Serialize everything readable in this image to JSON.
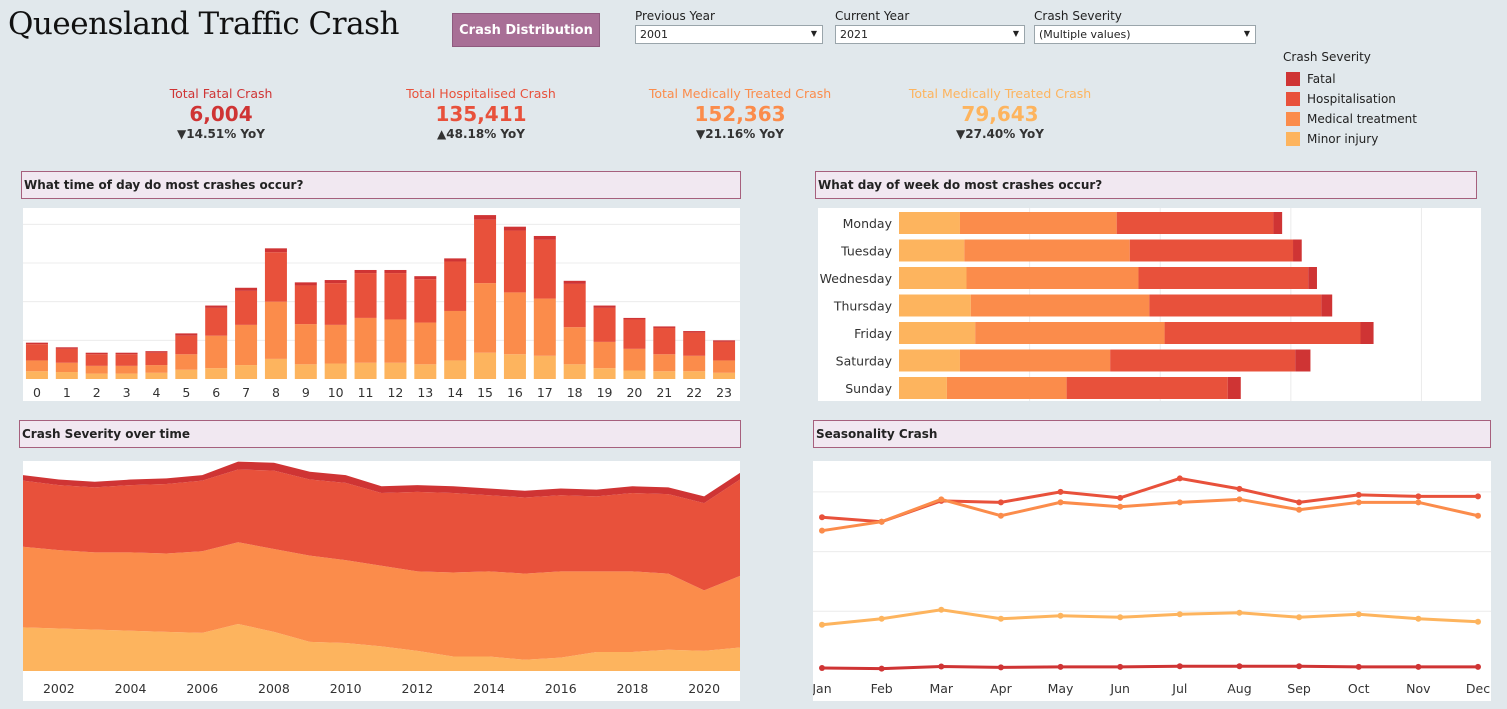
{
  "title": "Queensland Traffic Crash",
  "nav_button": "Crash Distribution",
  "filters": {
    "previous_year": {
      "label": "Previous Year",
      "value": "2001"
    },
    "current_year": {
      "label": "Current Year",
      "value": "2021"
    },
    "severity": {
      "label": "Crash Severity",
      "value": "(Multiple values)"
    }
  },
  "legend": {
    "title": "Crash Severity",
    "items": [
      {
        "label": "Fatal",
        "color": "#cf3434"
      },
      {
        "label": "Hospitalisation",
        "color": "#e8513b"
      },
      {
        "label": "Medical treatment",
        "color": "#fb8c4b"
      },
      {
        "label": "Minor injury",
        "color": "#fdb45e"
      }
    ]
  },
  "kpis": [
    {
      "label": "Total Fatal Crash",
      "value": "6,004",
      "yoy": "▼14.51% YoY",
      "color": "#cf3434"
    },
    {
      "label": "Total Hospitalised Crash",
      "value": "135,411",
      "yoy": "▲48.18% YoY",
      "color": "#e8513b"
    },
    {
      "label": "Total Medically Treated Crash",
      "value": "152,363",
      "yoy": "▼21.16% YoY",
      "color": "#fb8c4b"
    },
    {
      "label": "Total Medically Treated Crash",
      "value": "79,643",
      "yoy": "▼27.40% YoY",
      "color": "#fdb45e"
    }
  ],
  "sections": {
    "time_of_day": "What time of day do most crashes occur?",
    "day_of_week": "What day of week do most crashes occur?",
    "severity_time": "Crash Severity over time",
    "seasonality": "Seasonality Crash"
  },
  "chart_data": [
    {
      "type": "bar",
      "stacked": true,
      "orientation": "vertical",
      "categories": [
        "0",
        "1",
        "2",
        "3",
        "4",
        "5",
        "6",
        "7",
        "8",
        "9",
        "10",
        "11",
        "12",
        "13",
        "14",
        "15",
        "16",
        "17",
        "18",
        "19",
        "20",
        "21",
        "22",
        "23"
      ],
      "series": [
        {
          "name": "Minor injury",
          "values": [
            5,
            4.5,
            3.5,
            3.5,
            4,
            6,
            7,
            9,
            13,
            9.5,
            10,
            10.5,
            10.5,
            9.5,
            12,
            17,
            16,
            15,
            9.5,
            7,
            5.5,
            5,
            5,
            4
          ]
        },
        {
          "name": "Medical treatment",
          "values": [
            7,
            6,
            5,
            5,
            5,
            10,
            21,
            26,
            37,
            26,
            25,
            29,
            28,
            27,
            32,
            45,
            40,
            37,
            24,
            17,
            14,
            11,
            10,
            8
          ]
        },
        {
          "name": "Hospitalisation",
          "values": [
            10.5,
            9,
            7.5,
            7.5,
            8,
            12,
            18,
            22,
            32,
            25,
            27,
            29,
            30,
            28,
            32,
            41,
            40,
            38,
            28,
            22,
            19,
            17,
            15,
            12
          ]
        },
        {
          "name": "Fatal",
          "values": [
            1,
            1,
            1,
            1,
            1,
            1.5,
            1.5,
            2,
            2.5,
            2,
            2,
            2,
            2,
            2,
            2,
            3,
            2.5,
            2.5,
            2,
            1.5,
            1,
            1,
            1,
            1
          ]
        }
      ]
    },
    {
      "type": "bar",
      "stacked": true,
      "orientation": "horizontal",
      "categories": [
        "Monday",
        "Tuesday",
        "Wednesday",
        "Thursday",
        "Friday",
        "Saturday",
        "Sunday"
      ],
      "series": [
        {
          "name": "Minor injury",
          "values": [
            14,
            15,
            15.5,
            16.5,
            17.5,
            14,
            11
          ]
        },
        {
          "name": "Medical treatment",
          "values": [
            36,
            38,
            39.5,
            41,
            43.5,
            34.5,
            27.5
          ]
        },
        {
          "name": "Hospitalisation",
          "values": [
            36,
            37.5,
            39,
            39.5,
            45,
            42.5,
            37
          ]
        },
        {
          "name": "Fatal",
          "values": [
            2,
            2,
            2,
            2.5,
            3,
            3.5,
            3
          ]
        }
      ]
    },
    {
      "type": "area",
      "stacked": true,
      "x": [
        2001,
        2002,
        2003,
        2004,
        2005,
        2006,
        2007,
        2008,
        2009,
        2010,
        2011,
        2012,
        2013,
        2014,
        2015,
        2016,
        2017,
        2018,
        2019,
        2020,
        2021
      ],
      "x_ticks": [
        "2002",
        "2004",
        "2006",
        "2008",
        "2010",
        "2012",
        "2014",
        "2016",
        "2018",
        "2020"
      ],
      "series": [
        {
          "name": "Minor injury",
          "values": [
            19.5,
            19,
            18.5,
            18,
            17.5,
            17,
            21,
            17.5,
            13,
            12.5,
            11,
            9,
            6.5,
            6.5,
            5,
            6,
            8.5,
            8.5,
            9.5,
            9,
            10.5
          ]
        },
        {
          "name": "Medical treatment",
          "values": [
            36,
            35,
            34.5,
            35,
            35,
            36.5,
            36.5,
            37,
            38.5,
            37,
            36,
            35.5,
            37.5,
            38,
            38.5,
            38.5,
            36,
            36,
            34,
            27,
            32
          ]
        },
        {
          "name": "Hospitalisation",
          "values": [
            29.5,
            29,
            29,
            30,
            31,
            31.5,
            32.5,
            35,
            34,
            34.5,
            32.5,
            35.5,
            35.5,
            34,
            34,
            34,
            33.5,
            35,
            35.5,
            39,
            43
          ]
        },
        {
          "name": "Fatal",
          "values": [
            2.5,
            2.5,
            2.5,
            2.5,
            2.5,
            2.5,
            3.5,
            3.5,
            3.5,
            3.5,
            3,
            3,
            3,
            3,
            3,
            3,
            3,
            3,
            3,
            3,
            3
          ]
        }
      ]
    },
    {
      "type": "line",
      "x": [
        "Jan",
        "Feb",
        "Mar",
        "Apr",
        "May",
        "Jun",
        "Jul",
        "Aug",
        "Sep",
        "Oct",
        "Nov",
        "Dec"
      ],
      "series": [
        {
          "name": "Fatal",
          "values": [
            1,
            0.8,
            1.5,
            1.2,
            1.4,
            1.4,
            1.6,
            1.6,
            1.6,
            1.4,
            1.4,
            1.4
          ]
        },
        {
          "name": "Hospitalisation",
          "values": [
            51.5,
            50,
            57,
            56.5,
            60,
            58,
            64.5,
            61,
            56.5,
            59,
            58.5,
            58.5
          ]
        },
        {
          "name": "Medical treatment",
          "values": [
            47,
            50,
            57.5,
            52,
            56.5,
            55,
            56.5,
            57.5,
            54,
            56.5,
            56.5,
            52
          ]
        },
        {
          "name": "Minor injury",
          "values": [
            15.5,
            17.5,
            20.5,
            17.5,
            18.5,
            18,
            19,
            19.5,
            18,
            19,
            17.5,
            16.5
          ]
        }
      ]
    }
  ]
}
